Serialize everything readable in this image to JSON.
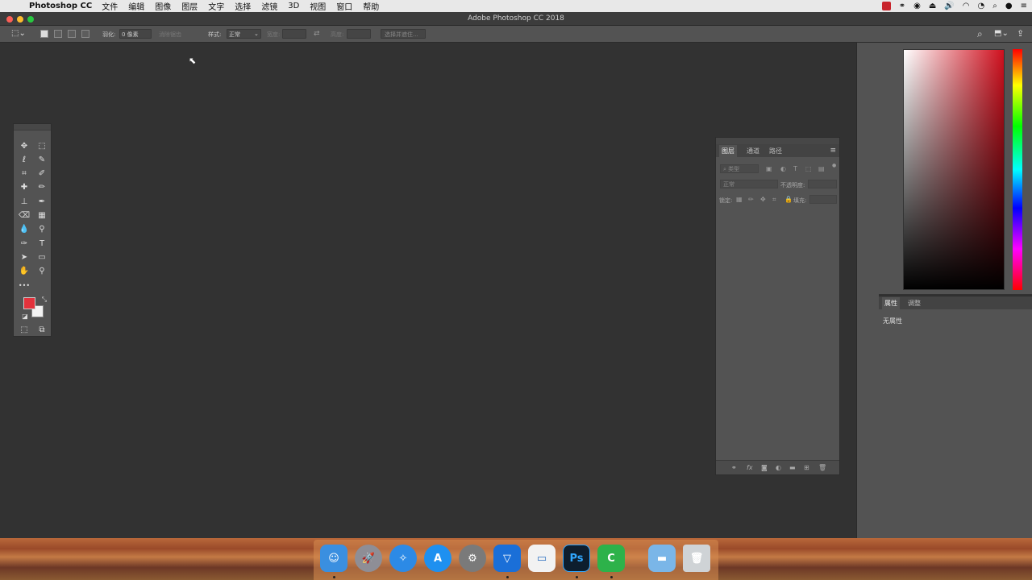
{
  "menubar": {
    "app_name": "Photoshop CC",
    "menus": [
      "文件",
      "编辑",
      "图像",
      "图层",
      "文字",
      "选择",
      "滤镜",
      "3D",
      "视图",
      "窗口",
      "帮助"
    ]
  },
  "window": {
    "title": "Adobe Photoshop CC 2018"
  },
  "options_bar": {
    "feather_label": "羽化:",
    "feather_value": "0 像素",
    "antialias_label": "消除锯齿",
    "style_label": "样式:",
    "style_value": "正常",
    "width_label": "宽度:",
    "height_label": "高度:",
    "select_mask_label": "选择并遮住..."
  },
  "tools": {
    "more": "•••",
    "foreground_color": "#e2323c",
    "background_color": "#f3f3f3"
  },
  "layers_panel": {
    "tabs": [
      "图层",
      "通道",
      "路径"
    ],
    "kind_filter": "类型",
    "blend_mode": "正常",
    "opacity_label": "不透明度:",
    "lock_label": "锁定:",
    "fill_label": "填充:"
  },
  "properties_panel": {
    "tabs": [
      "属性",
      "调整"
    ],
    "empty_text": "无属性"
  },
  "dock": {
    "apps": [
      "Finder",
      "Launchpad",
      "Safari",
      "App Store",
      "System Preferences",
      "Shield",
      "Keynote",
      "Ps",
      "Camtasia",
      "Folder",
      "Trash"
    ],
    "ps_label": "Ps",
    "camtasia_label": "C"
  }
}
